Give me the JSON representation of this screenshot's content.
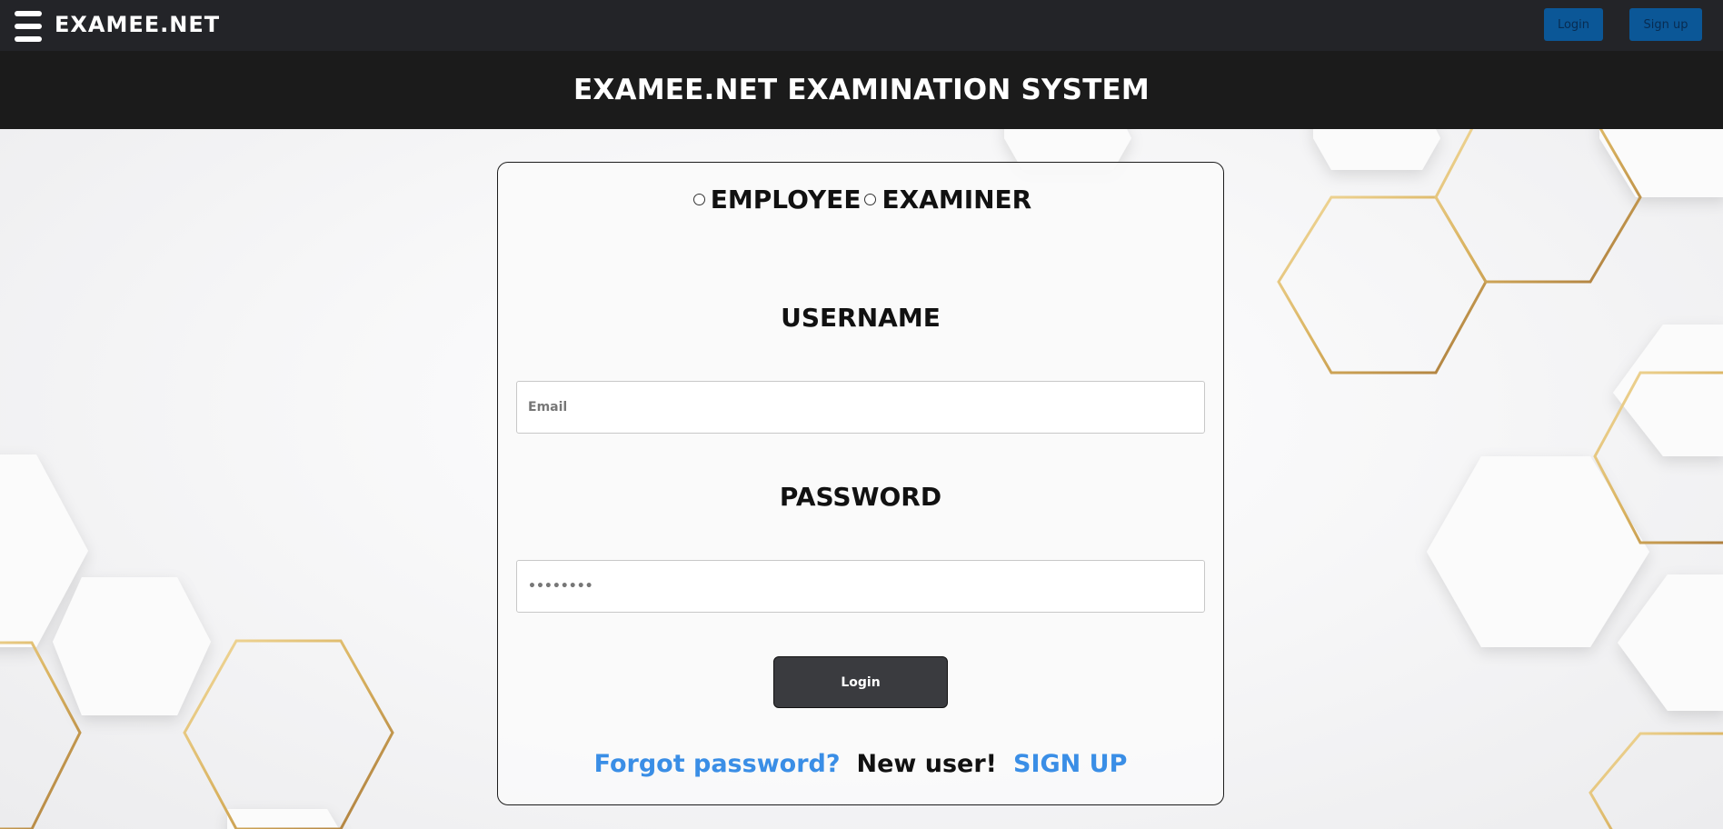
{
  "header": {
    "brand": "EXAMEE.NET",
    "login_label": "Login",
    "signup_label": "Sign up"
  },
  "page": {
    "title": "EXAMEE.NET EXAMINATION SYSTEM"
  },
  "form": {
    "roles": [
      {
        "label": "EMPLOYEE",
        "selected": false
      },
      {
        "label": "EXAMINER",
        "selected": false
      }
    ],
    "username_label": "USERNAME",
    "email_placeholder": "Email",
    "password_label": "PASSWORD",
    "password_placeholder": "••••••••",
    "login_button": "Login",
    "forgot_link": "Forgot password?",
    "new_user_text": "New user!",
    "signup_link": "SIGN UP"
  },
  "colors": {
    "topbar": "#232428",
    "titlebar": "#1b1b1b",
    "nav_button": "#0b5797",
    "link": "#3a8ee6",
    "gold": "#d9b25f"
  },
  "icons": {
    "menu": "hamburger-icon"
  }
}
